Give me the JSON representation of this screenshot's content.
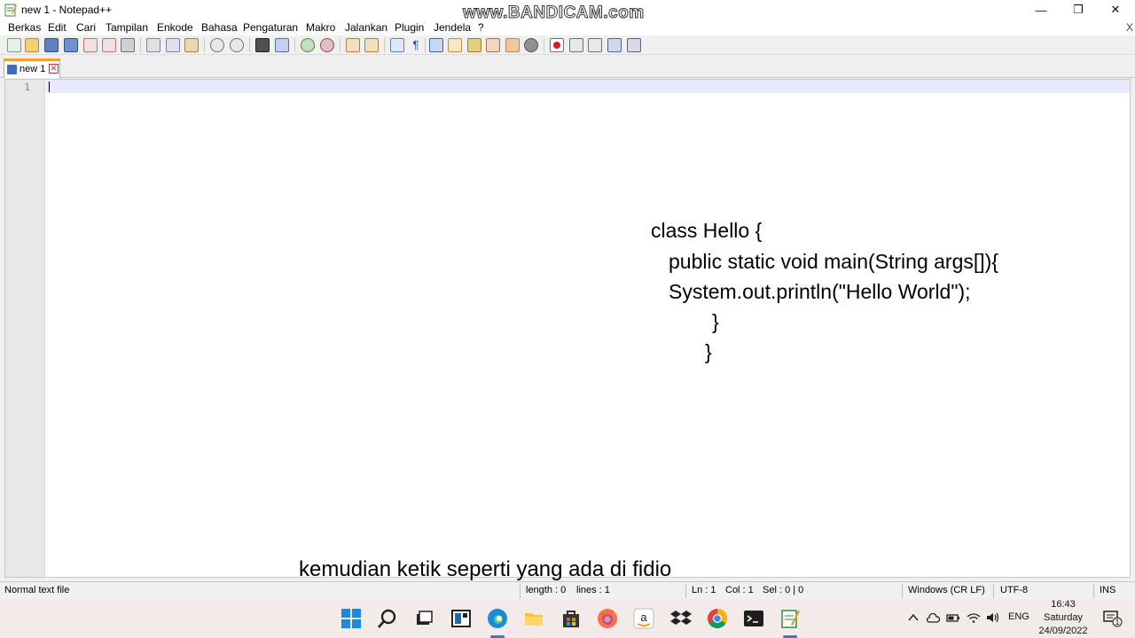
{
  "window": {
    "title": "new 1 - Notepad++",
    "watermark": "www.BANDICAM.com",
    "minimize_glyph": "—",
    "maximize_glyph": "❐",
    "close_glyph": "✕"
  },
  "menu": {
    "items": [
      "Berkas",
      "Edit",
      "Cari",
      "Tampilan",
      "Enkode",
      "Bahasa",
      "Pengaturan",
      "Makro",
      "Jalankan",
      "Plugin",
      "Jendela",
      "?"
    ],
    "close_glyph": "X"
  },
  "toolbar": {
    "icons": [
      "new-file-icon",
      "open-file-icon",
      "save-icon",
      "save-all-icon",
      "close-icon",
      "close-all-icon",
      "print-icon",
      "cut-icon",
      "copy-icon",
      "paste-icon",
      "undo-icon",
      "redo-icon",
      "find-icon",
      "replace-icon",
      "zoom-in-icon",
      "zoom-out-icon",
      "sync-vertical-icon",
      "sync-horizontal-icon",
      "word-wrap-icon",
      "show-all-chars-icon",
      "indent-guide-icon",
      "udl-icon",
      "doc-map-icon",
      "function-list-icon",
      "folder-workspace-icon",
      "monitoring-icon",
      "record-macro-icon",
      "stop-macro-icon",
      "play-macro-icon",
      "run-macro-multiple-icon",
      "save-macro-icon"
    ]
  },
  "tab": {
    "label": "new 1",
    "close_glyph": "✕"
  },
  "editor": {
    "line_numbers": [
      "1"
    ],
    "overlay_code": [
      "class Hello {",
      "public static void main(String args[]){",
      "System.out.println(\"Hello World\");",
      "}",
      "}"
    ],
    "caption": "kemudian ketik seperti yang ada di fidio"
  },
  "status": {
    "file_type": "Normal text file",
    "length": "length : 0",
    "lines": "lines : 1",
    "ln": "Ln : 1",
    "col": "Col : 1",
    "sel": "Sel : 0 | 0",
    "eol": "Windows (CR LF)",
    "encoding": "UTF-8",
    "mode": "INS"
  },
  "taskbar": {
    "apps": [
      "windows-start-icon",
      "search-icon",
      "task-view-icon",
      "widgets-icon",
      "edge-icon",
      "file-explorer-icon",
      "store-icon",
      "firefox-icon",
      "amazon-icon",
      "dropbox-icon",
      "chrome-icon",
      "terminal-icon",
      "notepadpp-icon"
    ],
    "tray": {
      "language": "ENG",
      "time": "16:43",
      "day": "Saturday",
      "date": "24/09/2022",
      "notification_count": "1"
    }
  },
  "colors": {
    "tab_accent": "#f0a030",
    "current_line": "#e8e8ff",
    "taskbar_bg": "#f3ebe9",
    "active_indicator": "#2d7dd2"
  }
}
